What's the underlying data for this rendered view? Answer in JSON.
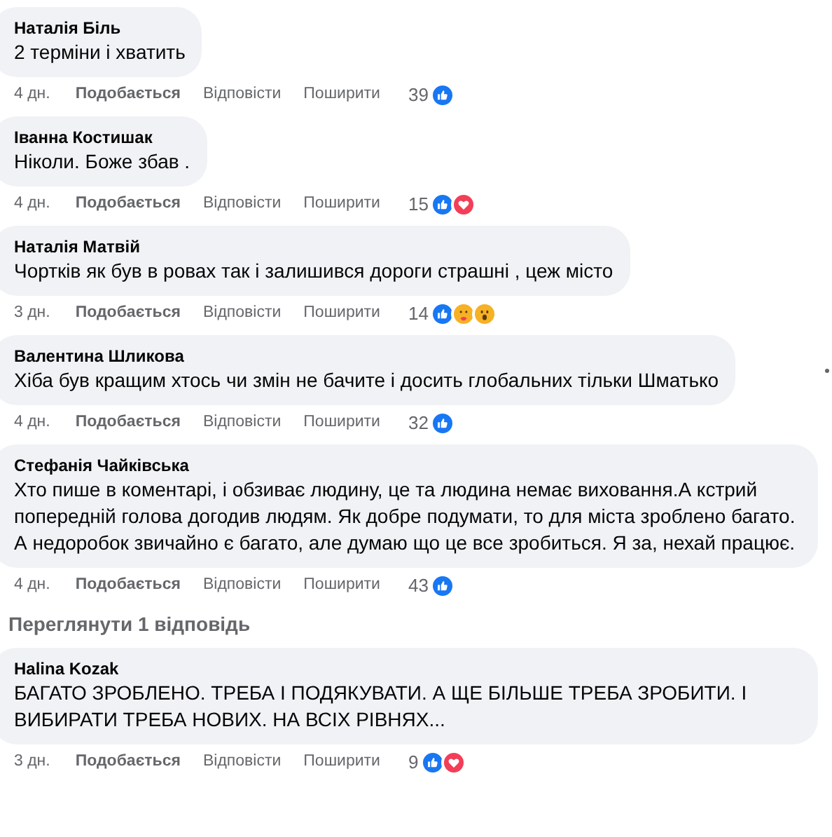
{
  "comments": [
    {
      "author": "Наталія Біль",
      "text": "2 терміни і хватить",
      "time": "4 дн.",
      "actions": [
        "Подобається",
        "Відповісти",
        "Поширити"
      ],
      "reaction_count": "39",
      "reactions": [
        {
          "kind": "like"
        }
      ]
    },
    {
      "author": "Іванна Костишак",
      "text": "Ніколи. Боже збав .",
      "time": "4 дн.",
      "actions": [
        "Подобається",
        "Відповісти",
        "Поширити"
      ],
      "reaction_count": "15",
      "reactions": [
        {
          "kind": "like"
        },
        {
          "kind": "love"
        }
      ]
    },
    {
      "author": "Наталія Матвій",
      "text": "Чортків як був в ровах так і залишився дороги страшні , цеж місто",
      "time": "3 дн.",
      "actions": [
        "Подобається",
        "Відповісти",
        "Поширити"
      ],
      "reaction_count": "14",
      "reactions": [
        {
          "kind": "like"
        },
        {
          "kind": "care"
        },
        {
          "kind": "wow"
        }
      ]
    },
    {
      "author": "Валентина Шликова",
      "text": "Хіба був кращим хтось чи змін не бачите і досить глобальних тільки Шматько",
      "time": "4 дн.",
      "actions": [
        "Подобається",
        "Відповісти",
        "Поширити"
      ],
      "reaction_count": "32",
      "reactions": [
        {
          "kind": "like"
        }
      ],
      "menu": true
    },
    {
      "author": "Стефанія Чайківська",
      "text": "Хто пише в коментарі, і обзиває людину, це та людина немає виховання.А кстрий попередній голова догодив людям. Як добре подумати, то для міста зроблено багато. А недоробок звичайно є багато, але думаю що це все зробиться. Я за, нехай працює.",
      "time": "4 дн.",
      "actions": [
        "Подобається",
        "Відповісти",
        "Поширити"
      ],
      "reaction_count": "43",
      "reactions": [
        {
          "kind": "like"
        }
      ],
      "view_replies": "Переглянути 1 відповідь"
    },
    {
      "author": "Halina Kozak",
      "text": "БАГАТО ЗРОБЛЕНО. ТРЕБА І ПОДЯКУВАТИ. А ЩЕ БІЛЬШЕ ТРЕБА ЗРОБИТИ. І ВИБИРАТИ ТРЕБА НОВИХ. НА ВСІХ РІВНЯХ...",
      "time": "3 дн.",
      "actions": [
        "Подобається",
        "Відповісти",
        "Поширити"
      ],
      "reaction_count": "9",
      "reactions": [
        {
          "kind": "like"
        },
        {
          "kind": "love"
        }
      ]
    }
  ]
}
